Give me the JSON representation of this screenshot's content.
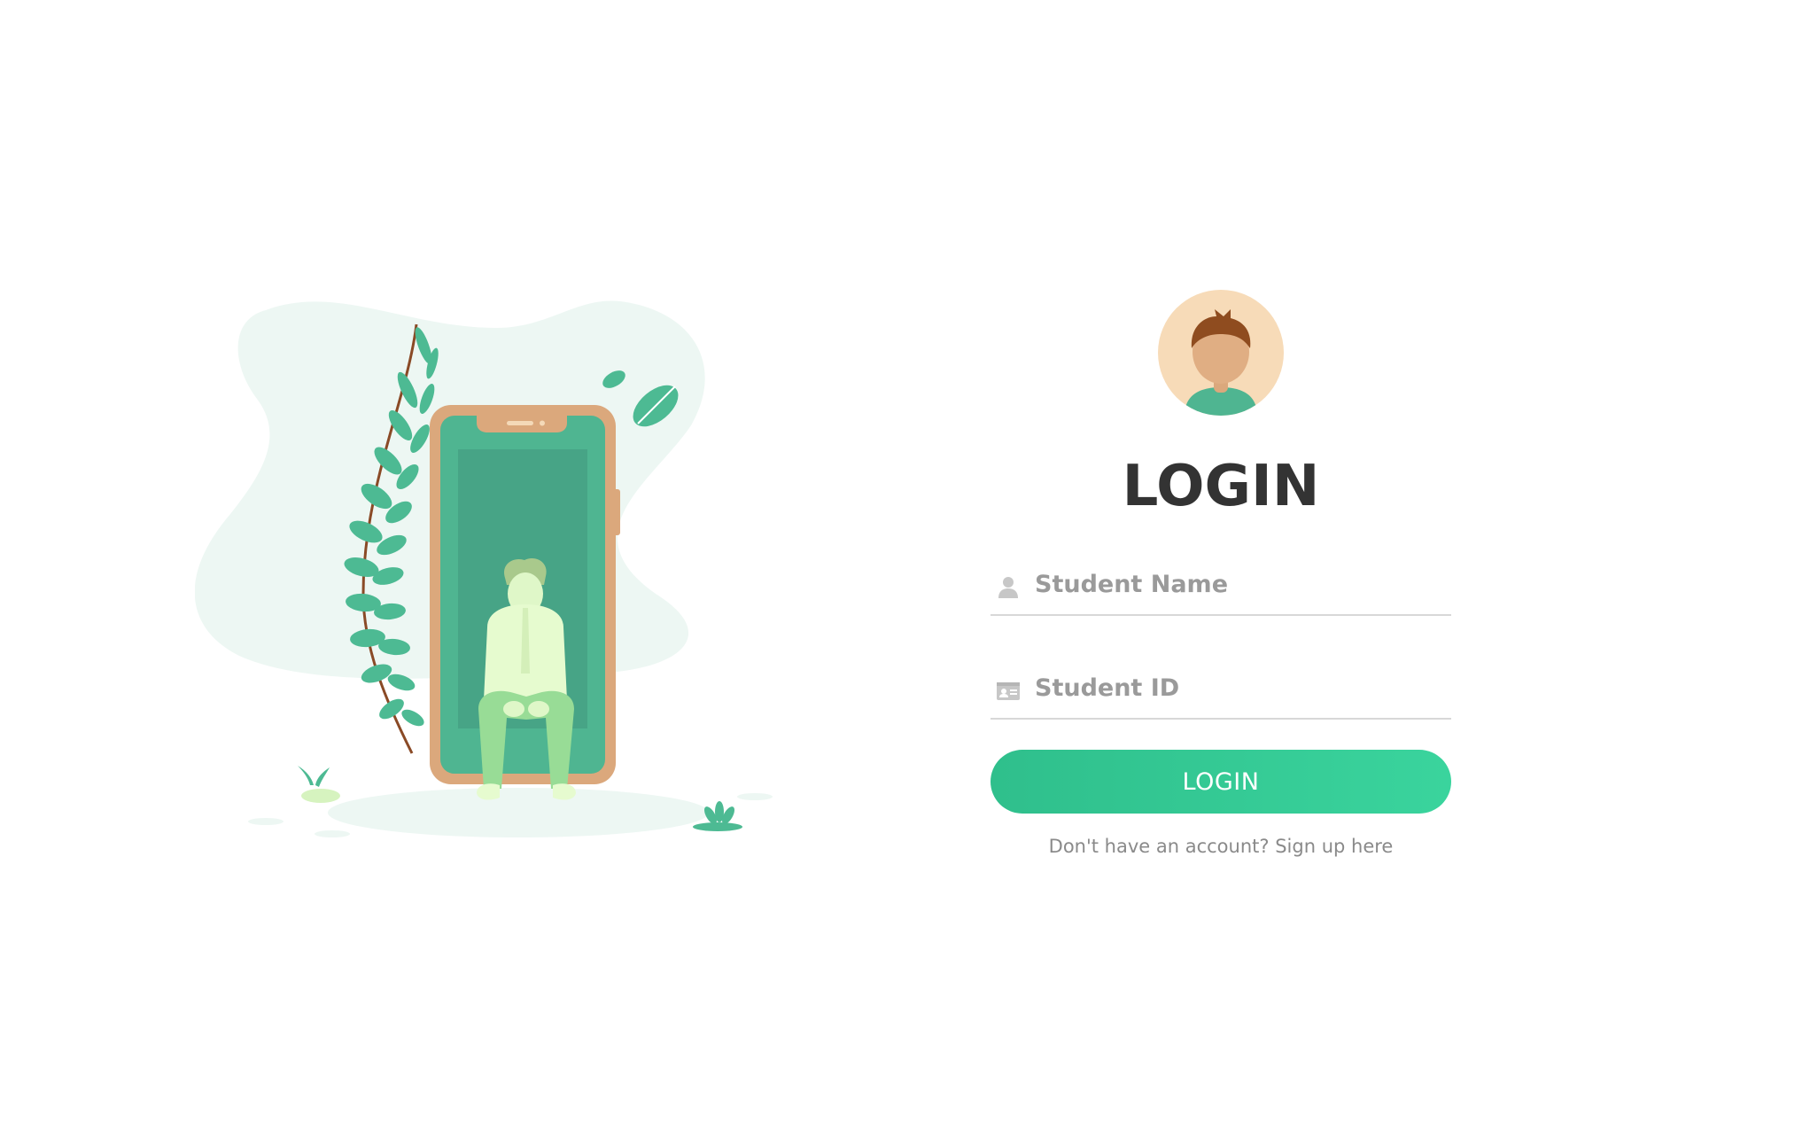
{
  "title": "LOGIN",
  "form": {
    "student_name_placeholder": "Student Name",
    "student_name_value": "",
    "student_id_placeholder": "Student ID",
    "student_id_value": "",
    "login_button_label": "LOGIN"
  },
  "signup": {
    "prefix": "Don't have an account? ",
    "link_label": "Sign up here"
  },
  "icons": {
    "name_field": "user-icon",
    "id_field": "id-card-icon"
  },
  "colors": {
    "accent": "#33c996",
    "accent_gradient_start": "#2fbf8c",
    "accent_gradient_end": "#3ad49d",
    "title": "#333333",
    "placeholder": "#9a9a9a",
    "underline": "#d8d8d8",
    "blob": "#edf7f3",
    "leaf": "#4dba93",
    "phone_frame": "#dba87c",
    "avatar_bg": "#f7dbb8"
  }
}
